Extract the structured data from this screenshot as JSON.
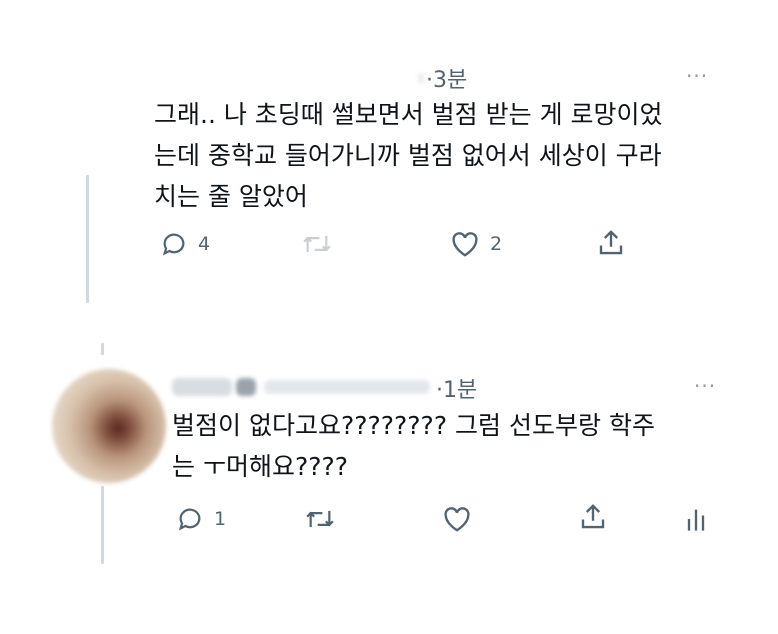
{
  "tweet1": {
    "time": "·3분",
    "more": "···",
    "text": "그래.. 나 초딩때 썰보면서 벌점 받는 게 로망이었\n는데 중학교 들어가니까 벌점 없어서 세상이 구라\n치는 줄 알았어",
    "actions": {
      "reply_count": "4",
      "retweet_count": "",
      "like_count": "2"
    }
  },
  "tweet2": {
    "time": "·1분",
    "more": "···",
    "text": "벌점이 없다고요???????? 그럼 선도부랑 학주\n는 ㅜ머해요????",
    "actions": {
      "reply_count": "1",
      "retweet_count": "",
      "like_count": ""
    }
  },
  "colors": {
    "text": "#0f1419",
    "muted": "#536471",
    "thread_line": "#cfd9de"
  },
  "icons": [
    "reply-icon",
    "retweet-icon",
    "like-icon",
    "share-icon",
    "analytics-icon",
    "more-icon"
  ]
}
